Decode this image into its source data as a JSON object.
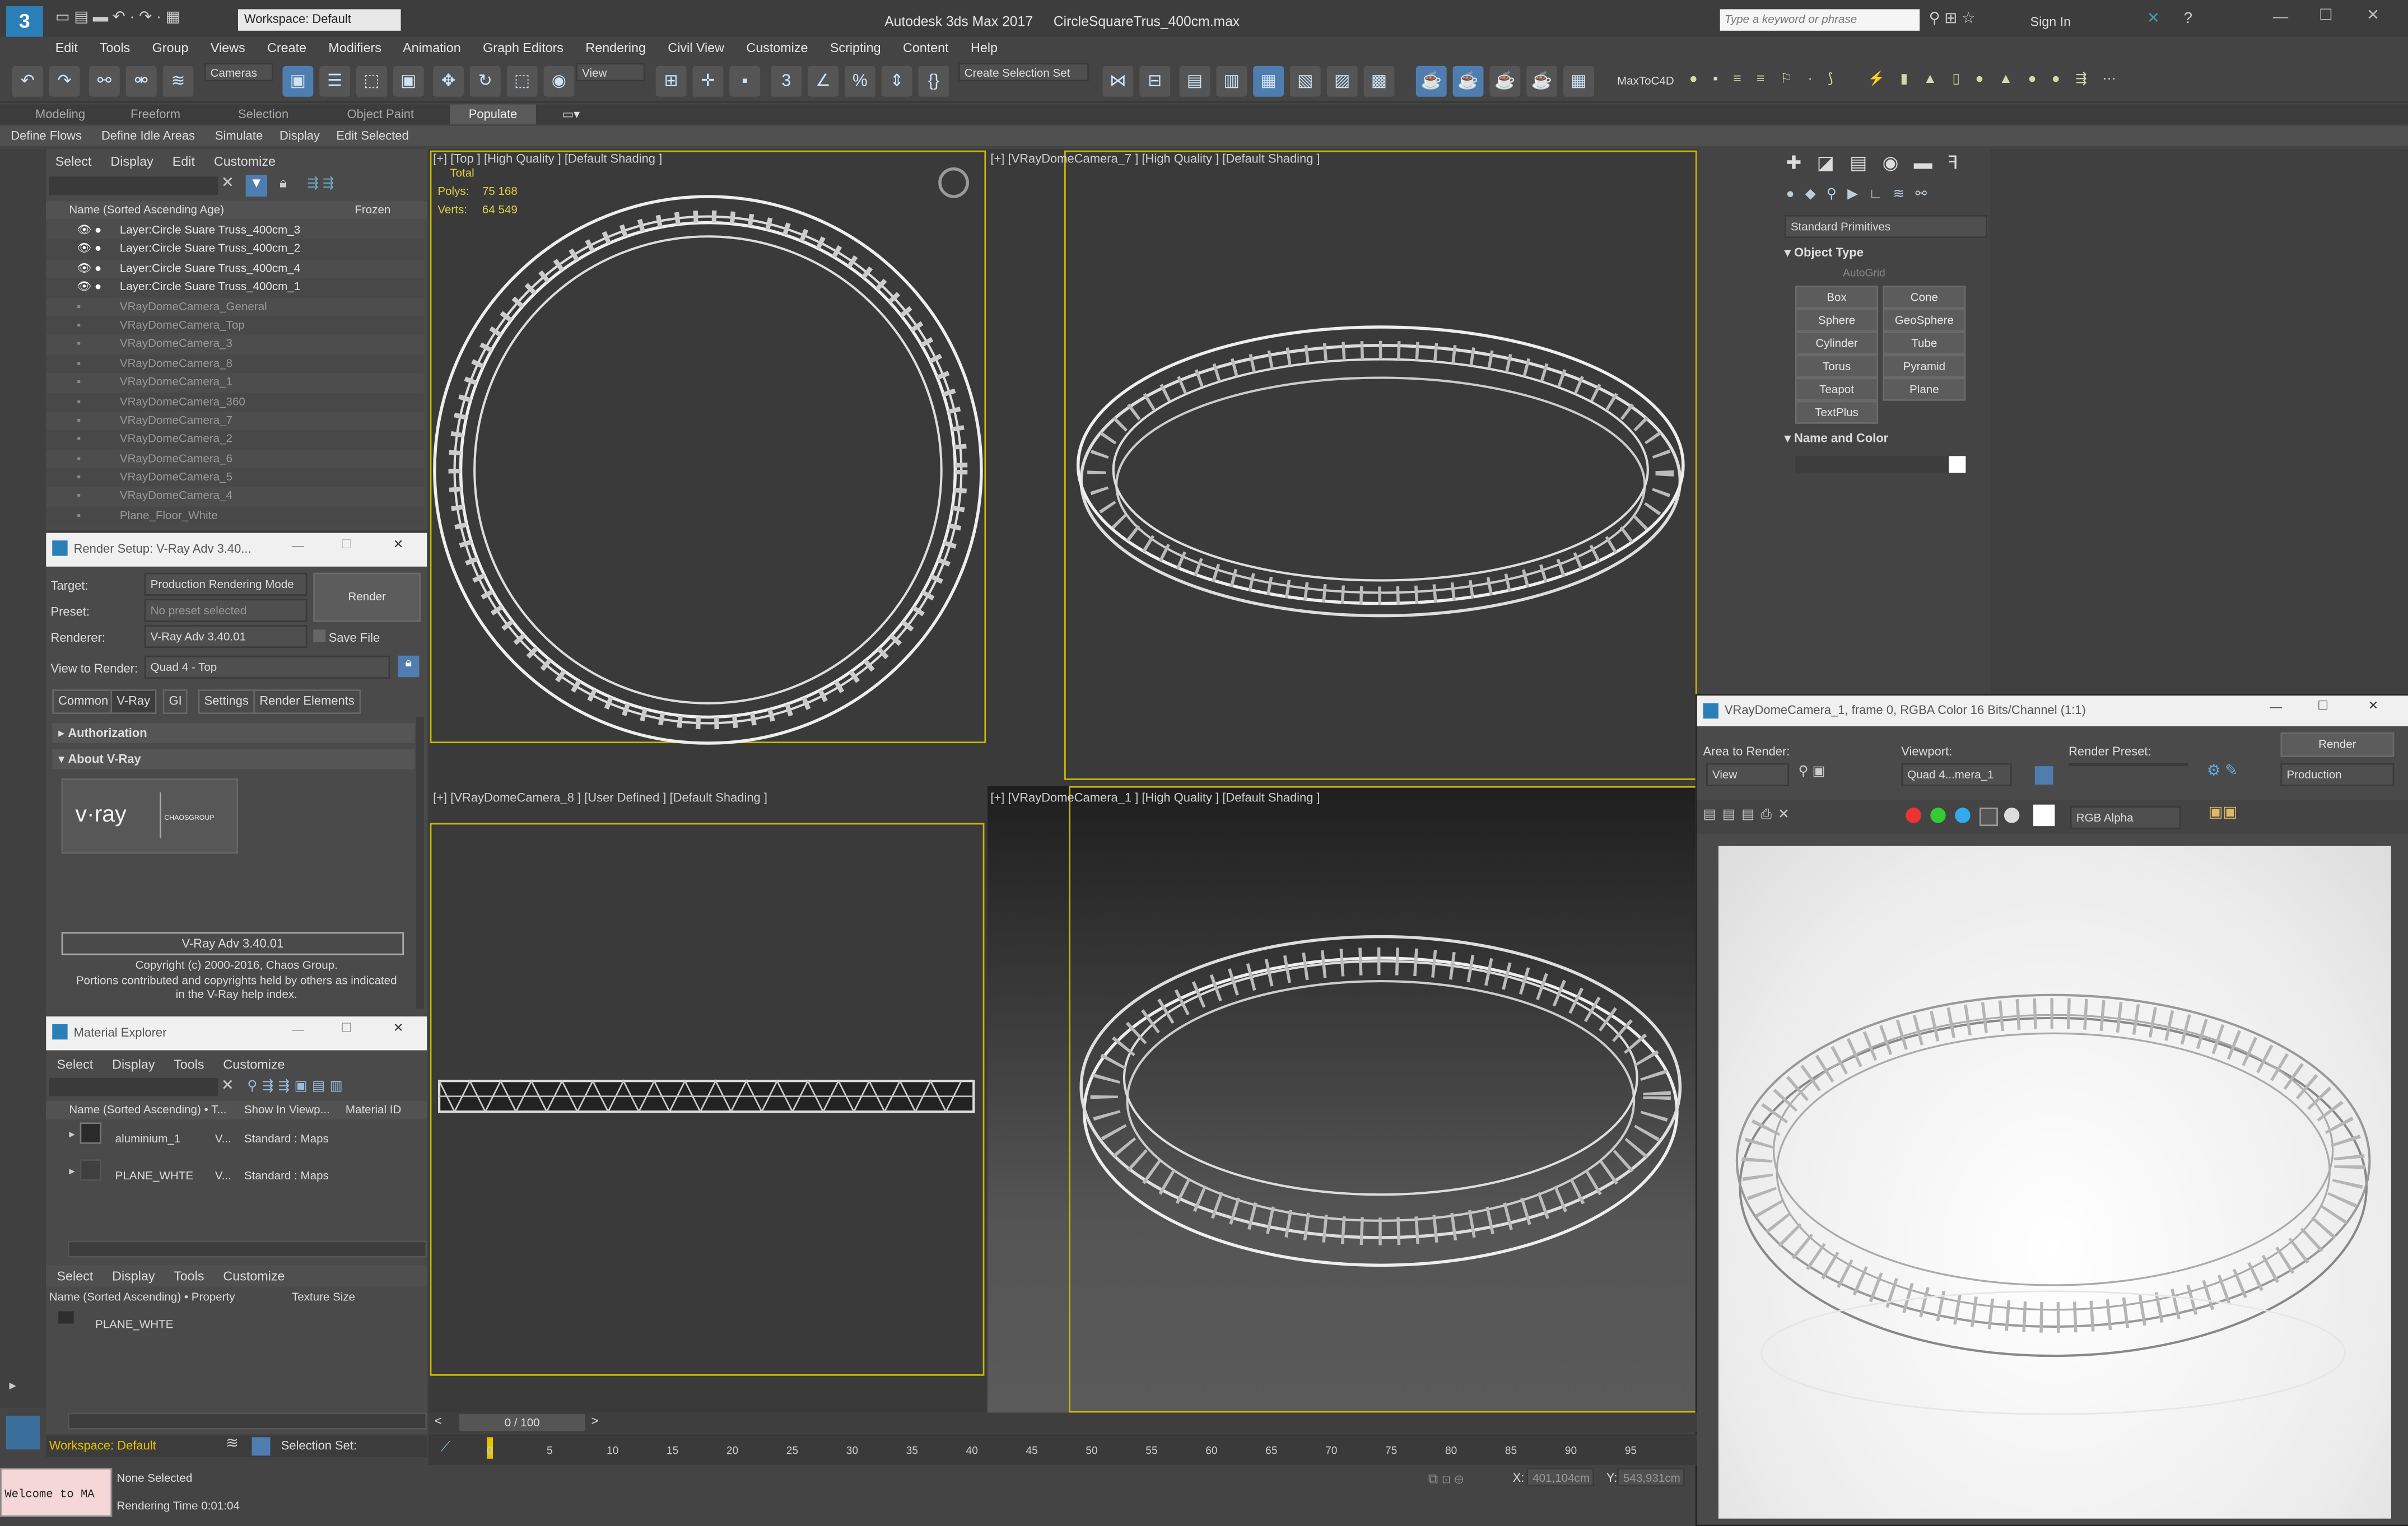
{
  "titlebar": {
    "workspace": "Workspace: Default",
    "app_title": "Autodesk 3ds Max 2017",
    "file_name": "CircleSquareTrus_400cm.max",
    "search_placeholder": "Type a keyword or phrase",
    "sign_in": "Sign In"
  },
  "menu": [
    "Edit",
    "Tools",
    "Group",
    "Views",
    "Create",
    "Modifiers",
    "Animation",
    "Graph Editors",
    "Rendering",
    "Civil View",
    "Customize",
    "Scripting",
    "Content",
    "Help"
  ],
  "toolbar": {
    "selection_filter": "Cameras",
    "ref_coord": "View",
    "create_selection_set": "Create Selection Set",
    "maxtoc4d": "MaxToC4D"
  },
  "ribbon_tabs": [
    "Modeling",
    "Freeform",
    "Selection",
    "Object Paint",
    "Populate"
  ],
  "populate_tabs": [
    "Define Flows",
    "Define Idle Areas",
    "Simulate",
    "Display",
    "Edit Selected"
  ],
  "scene_explorer": {
    "menu": [
      "Select",
      "Display",
      "Edit",
      "Customize"
    ],
    "col_name": "Name (Sorted Ascending Age)",
    "col_frozen": "Frozen",
    "rows": [
      "Layer:Circle Suare Truss_400cm_3",
      "Layer:Circle Suare Truss_400cm_2",
      "Layer:Circle Suare Truss_400cm_4",
      "Layer:Circle Suare Truss_400cm_1",
      "VRayDomeCamera_General",
      "VRayDomeCamera_Top",
      "VRayDomeCamera_3",
      "VRayDomeCamera_8",
      "VRayDomeCamera_1",
      "VRayDomeCamera_360",
      "VRayDomeCamera_7",
      "VRayDomeCamera_2",
      "VRayDomeCamera_6",
      "VRayDomeCamera_5",
      "VRayDomeCamera_4",
      "Plane_Floor_White"
    ]
  },
  "render_setup": {
    "title": "Render Setup: V-Ray Adv 3.40...",
    "target_label": "Target:",
    "target_value": "Production Rendering Mode",
    "preset_label": "Preset:",
    "preset_value": "No preset selected",
    "renderer_label": "Renderer:",
    "renderer_value": "V-Ray Adv 3.40.01",
    "save_file": "Save File",
    "view_label": "View to Render:",
    "view_value": "Quad 4 - Top",
    "render_btn": "Render",
    "tabs": [
      "Common",
      "V-Ray",
      "GI",
      "Settings",
      "Render Elements"
    ],
    "rollout_auth": "Authorization",
    "rollout_about": "About V-Ray",
    "vray_logo": "v·ray",
    "chaos_logo": "CHAOSGROUP",
    "version": "V-Ray Adv 3.40.01",
    "copyright1": "Copyright (c) 2000-2016, Chaos Group.",
    "copyright2": "Portions contributed and copyrights held by others as indicated",
    "copyright3": "in the V-Ray help index."
  },
  "material_explorer": {
    "title": "Material Explorer",
    "menu": [
      "Select",
      "Display",
      "Tools",
      "Customize"
    ],
    "col_name": "Name (Sorted Ascending) • T...",
    "col_show": "Show In Viewp...",
    "col_mat_id": "Material ID",
    "rows": [
      {
        "name": "aluminium_1",
        "type": "V...",
        "show": "Standard : Maps"
      },
      {
        "name": "PLANE_WHTE",
        "type": "V...",
        "show": "Standard : Maps"
      }
    ],
    "menu2": [
      "Select",
      "Display",
      "Tools",
      "Customize"
    ],
    "col2_name": "Name (Sorted Ascending) • Property",
    "col2_tex": "Texture Size",
    "row2": "PLANE_WHTE"
  },
  "viewports": {
    "top": {
      "label": "[+] [Top ] [High Quality ] [Default Shading ]",
      "stat_total": "Total",
      "polys_label": "Polys:",
      "polys": "75 168",
      "verts_label": "Verts:",
      "verts": "64 549"
    },
    "cam7": {
      "label": "[+] [VRayDomeCamera_7 ] [High Quality ] [Default Shading ]"
    },
    "cam8": {
      "label": "[+] [VRayDomeCamera_8 ] [User Defined ] [Default Shading ]"
    },
    "cam1": {
      "label": "[+] [VRayDomeCamera_1 ] [High Quality ] [Default Shading ]"
    }
  },
  "command_panel": {
    "dropdown": "Standard Primitives",
    "object_type": "Object Type",
    "autogrid": "AutoGrid",
    "buttons": [
      "Box",
      "Cone",
      "Sphere",
      "GeoSphere",
      "Cylinder",
      "Tube",
      "Torus",
      "Pyramid",
      "Teapot",
      "Plane",
      "TextPlus"
    ],
    "name_color": "Name and Color"
  },
  "frame_buffer": {
    "title": "VRayDomeCamera_1, frame 0, RGBA Color 16 Bits/Channel (1:1)",
    "area_label": "Area to Render:",
    "area_value": "View",
    "viewport_label": "Viewport:",
    "viewport_value": "Quad 4...mera_1",
    "preset_label": "Render Preset:",
    "render_btn": "Render",
    "production": "Production",
    "channel": "RGB Alpha"
  },
  "timeline": {
    "frame": "0 / 100",
    "ticks": [
      "0",
      "5",
      "10",
      "15",
      "20",
      "25",
      "30",
      "35",
      "40",
      "45",
      "50",
      "55",
      "60",
      "65",
      "70",
      "75",
      "80",
      "85",
      "90",
      "95"
    ]
  },
  "status": {
    "workspace": "Workspace: Default",
    "selection_set": "Selection Set:",
    "maxscript": "Welcome to MA",
    "none_selected": "None Selected",
    "render_time": "Rendering Time  0:01:04",
    "x_label": "X:",
    "x_value": "401,104cm",
    "y_label": "Y:",
    "y_value": "543,931cm"
  }
}
